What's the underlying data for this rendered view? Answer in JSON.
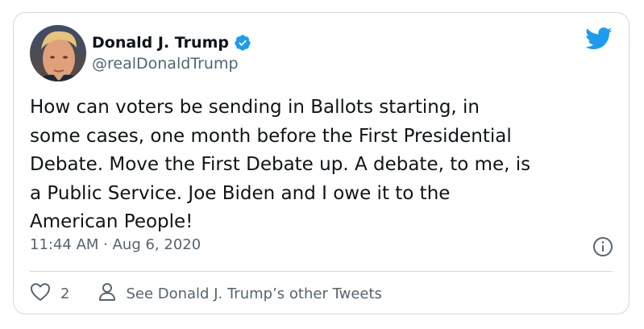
{
  "tweet": {
    "author": {
      "display_name": "Donald J. Trump",
      "handle": "@realDonaldTrump",
      "verified": true
    },
    "text": "How can voters be sending in Ballots starting, in\nsome cases, one month before the First Presidential\nDebate. Move the First Debate up. A debate, to me, is\na Public Service. Joe Biden and I owe it to the\nAmerican People!",
    "timestamp": "11:44 AM · Aug 6, 2020",
    "like_count": "2",
    "other_tweets_label": "See Donald J. Trump’s other Tweets"
  },
  "icons": {
    "brand": "twitter-bird-icon",
    "verified": "verified-badge-icon",
    "info": "info-icon",
    "like": "heart-icon",
    "profile": "person-icon"
  },
  "colors": {
    "brand_blue": "#1d9bf0",
    "text_primary": "#0f1419",
    "text_secondary": "#536471",
    "border": "#cfd9de"
  }
}
